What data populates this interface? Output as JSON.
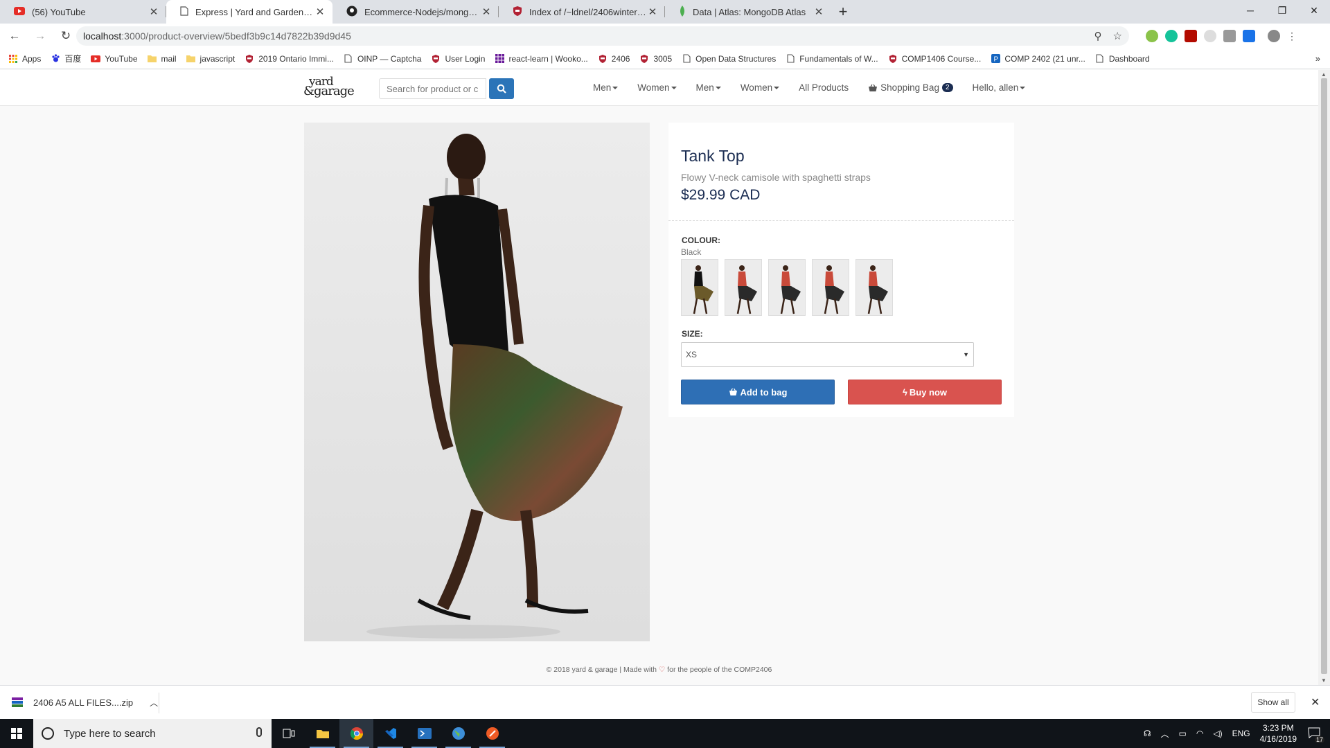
{
  "browser": {
    "tabs": [
      {
        "title": "(56) YouTube",
        "icon": "youtube-icon"
      },
      {
        "title": "Express | Yard and Garden Store",
        "icon": "page-icon"
      },
      {
        "title": "Ecommerce-Nodejs/mongo-conf",
        "icon": "github-icon"
      },
      {
        "title": "Index of /~ldnel/2406winter2019",
        "icon": "shield-icon"
      },
      {
        "title": "Data | Atlas: MongoDB Atlas",
        "icon": "leaf-icon"
      }
    ],
    "active_tab": 1,
    "url_host": "localhost",
    "url_path": ":3000/product-overview/5bedf3b9c14d7822b39d9d45",
    "bookmarks": [
      {
        "label": "Apps",
        "icon": "apps-grid-icon"
      },
      {
        "label": "百度",
        "icon": "baidu-paw-icon"
      },
      {
        "label": "YouTube",
        "icon": "youtube-icon"
      },
      {
        "label": "mail",
        "icon": "folder-icon"
      },
      {
        "label": "javascript",
        "icon": "folder-icon"
      },
      {
        "label": "2019 Ontario Immi...",
        "icon": "shield-icon"
      },
      {
        "label": "OINP — Captcha",
        "icon": "page-icon"
      },
      {
        "label": "User Login",
        "icon": "shield-icon"
      },
      {
        "label": "react-learn | Wooko...",
        "icon": "grid-icon"
      },
      {
        "label": "2406",
        "icon": "shield-icon"
      },
      {
        "label": "3005",
        "icon": "shield-icon"
      },
      {
        "label": "Open Data Structures",
        "icon": "page-icon"
      },
      {
        "label": "Fundamentals of W...",
        "icon": "page-icon"
      },
      {
        "label": "COMP1406 Course...",
        "icon": "shield-icon"
      },
      {
        "label": "COMP 2402 (21 unr...",
        "icon": "p-icon"
      },
      {
        "label": "Dashboard",
        "icon": "page-icon"
      }
    ],
    "bookmarks_more": "»"
  },
  "site": {
    "logo_line1": "yard",
    "logo_line2": "&garage",
    "search_placeholder": "Search for product or c",
    "menu": [
      "Men",
      "Women",
      "Men",
      "Women"
    ],
    "all_products": "All Products",
    "bag_label": "Shopping Bag",
    "bag_count": "2",
    "greeting": "Hello, allen"
  },
  "product": {
    "title": "Tank Top",
    "description": "Flowy V-neck camisole with spaghetti straps",
    "price": "$29.99 CAD",
    "colour_label": "COLOUR:",
    "colour_value": "Black",
    "swatch_count": 5,
    "size_label": "SIZE:",
    "size_value": "XS",
    "add_to_bag": "Add to bag",
    "buy_now": "Buy now"
  },
  "footer": {
    "before": "© 2018 yard & garage | Made with ",
    "heart": "♡",
    "after": " for the people of the COMP2406"
  },
  "download": {
    "filename": "2406 A5 ALL FILES....zip",
    "show_all": "Show all"
  },
  "taskbar": {
    "search_placeholder": "Type here to search",
    "lang": "ENG",
    "time": "3:23 PM",
    "date": "4/16/2019",
    "notifications": "17"
  },
  "colors": {
    "accent_blue": "#2e6fb5",
    "buy_red": "#d9534f",
    "title_navy": "#1b2d52"
  }
}
